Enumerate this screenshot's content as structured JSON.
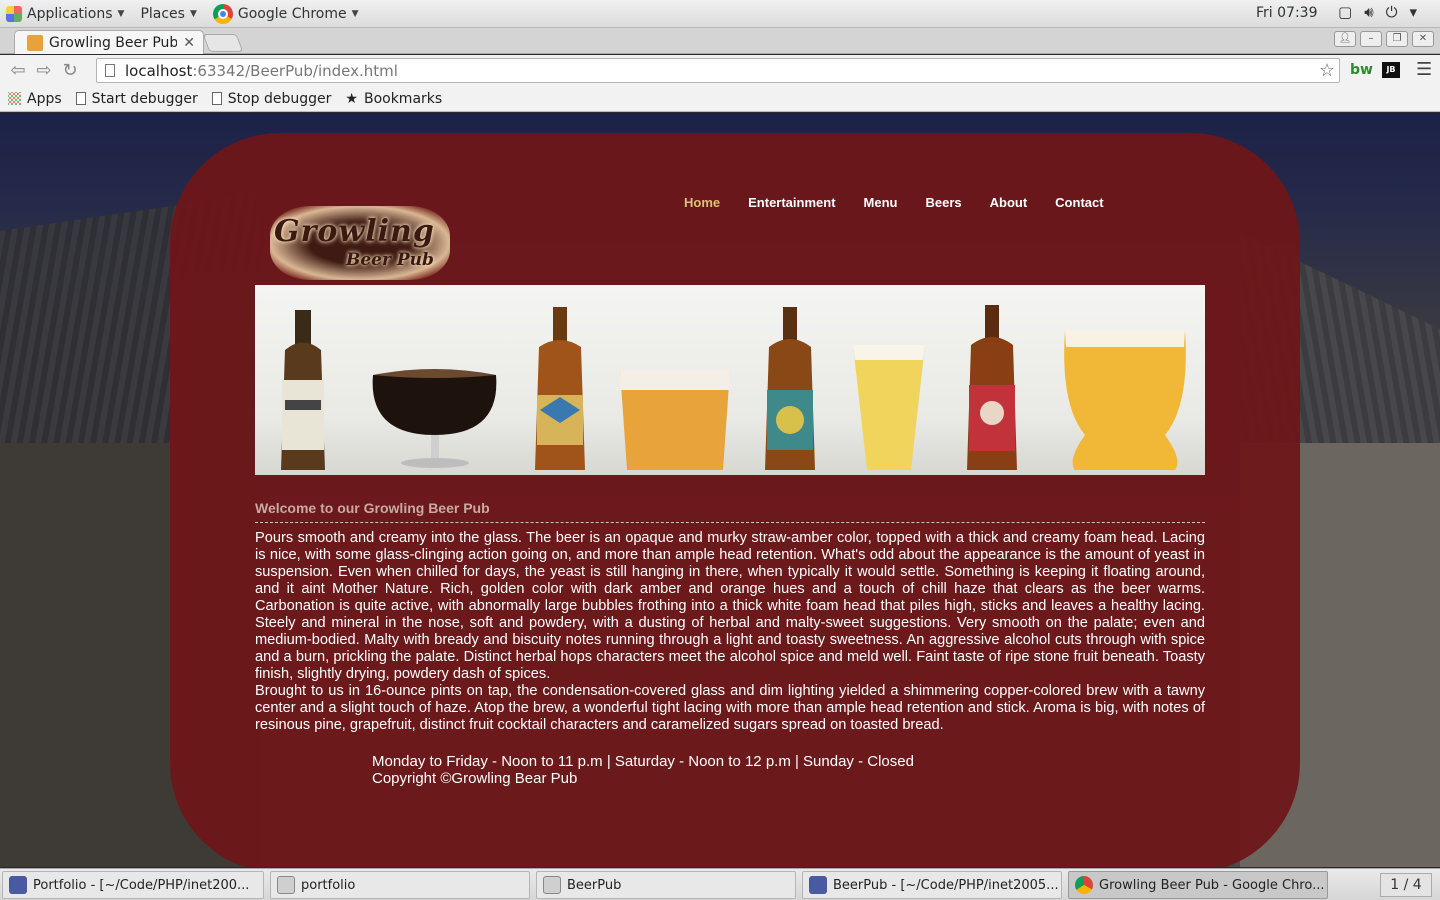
{
  "panel": {
    "applications": "Applications",
    "places": "Places",
    "active_app": "Google Chrome",
    "clock": "Fri 07:39"
  },
  "browser": {
    "tab_title": "Growling Beer Pub",
    "url_host": "localhost",
    "url_rest": ":63342/BeerPub/index.html",
    "bookmarks": [
      "Apps",
      "Start debugger",
      "Stop debugger",
      "Bookmarks"
    ]
  },
  "site": {
    "nav": [
      "Home",
      "Entertainment",
      "Menu",
      "Beers",
      "About",
      "Contact"
    ],
    "logo_main": "Growling",
    "logo_sub": "Beer Pub",
    "welcome": "Welcome to our Growling Beer Pub",
    "paragraph1": "Pours smooth and creamy into the glass. The beer is an opaque and murky straw-amber color, topped with a thick and creamy foam head. Lacing is nice, with some glass-clinging action going on, and more than ample head retention. What's odd about the appearance is the amount of yeast in suspension. Even when chilled for days, the yeast is still hanging in there, when typically it would settle. Something is keeping it floating around, and it aint Mother Nature. Rich, golden color with dark amber and orange hues and a touch of chill haze that clears as the beer warms. Carbonation is quite active, with abnormally large bubbles frothing into a thick white foam head that piles high, sticks and leaves a healthy lacing. Steely and mineral in the nose, soft and powdery, with a dusting of herbal and malty-sweet suggestions. Very smooth on the palate; even and medium-bodied. Malty with bready and biscuity notes running through a light and toasty sweetness. An aggressive alcohol cuts through with spice and a burn, prickling the palate. Distinct herbal hops characters meet the alcohol spice and meld well. Faint taste of ripe stone fruit beneath. Toasty finish, slightly drying, powdery dash of spices.",
    "paragraph2": "Brought to us in 16-ounce pints on tap, the condensation-covered glass and dim lighting yielded a shimmering copper-colored brew with a tawny center and a slight touch of haze. Atop the brew, a wonderful tight lacing with more than ample head retention and stick. Aroma is big, with notes of resinous pine, grapefruit, distinct fruit cocktail characters and caramelized sugars spread on toasted bread.",
    "hours": "Monday to Friday - Noon to 11 p.m | Saturday - Noon to 12 p.m | Sunday - Closed",
    "copyright": "Copyright ©Growling Bear Pub"
  },
  "taskbar": {
    "items": [
      "Portfolio - [~/Code/PHP/inet200...",
      "portfolio",
      "BeerPub",
      "BeerPub - [~/Code/PHP/inet2005...",
      "Growling Beer Pub - Google Chro..."
    ],
    "workspace": "1 / 4"
  },
  "colors": {
    "card": "#6e161a",
    "nav_active": "#d9c27a"
  }
}
